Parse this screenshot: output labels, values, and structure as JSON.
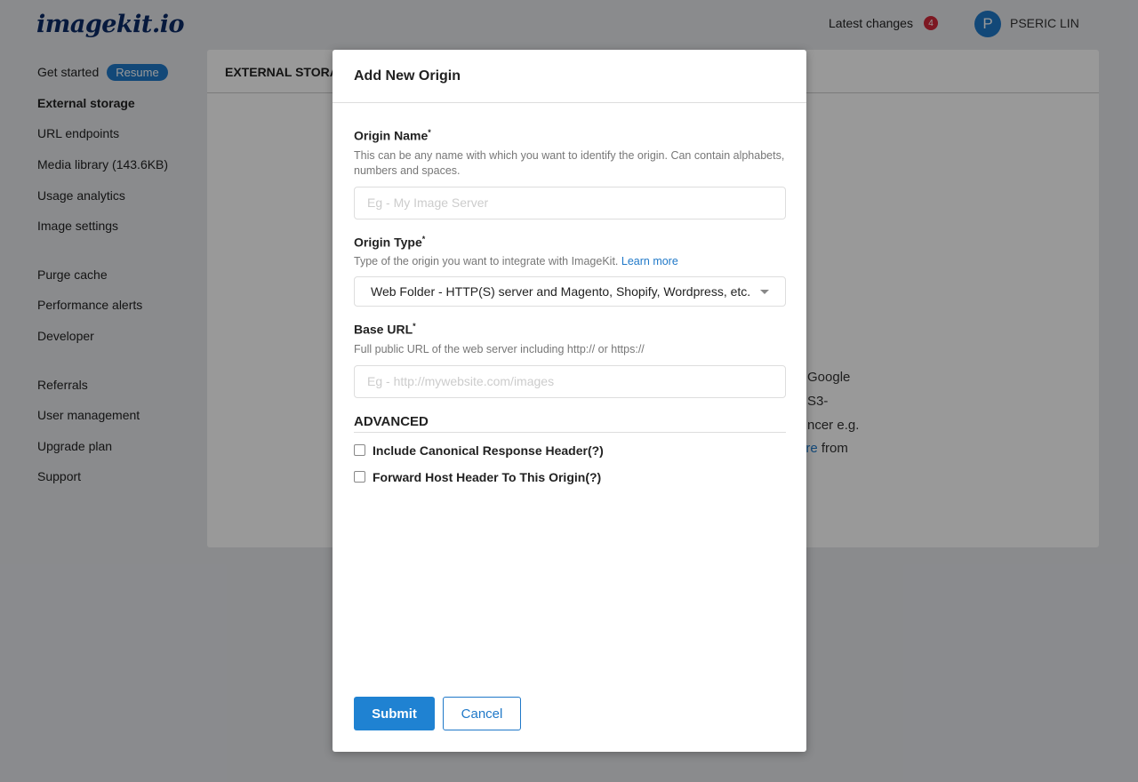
{
  "header": {
    "logo": "imagekit.io",
    "latest_changes": "Latest changes",
    "badge_count": "4",
    "avatar_initial": "P",
    "user_name": "PSERIC LIN"
  },
  "sidebar": {
    "resume": "Resume",
    "groups": [
      [
        "Get started",
        "External storage",
        "URL endpoints",
        "Media library (143.6KB)",
        "Usage analytics",
        "Image settings"
      ],
      [
        "Purge cache",
        "Performance alerts",
        "Developer"
      ],
      [
        "Referrals",
        "User management",
        "Upgrade plan",
        "Support"
      ]
    ],
    "active": "External storage"
  },
  "card": {
    "title": "EXTERNAL STORAGE",
    "fragments": [
      "Google",
      "S3-",
      "ncer e.g.",
      "from"
    ],
    "link_fragment": "ore"
  },
  "modal": {
    "title": "Add New Origin",
    "origin_name": {
      "label": "Origin Name",
      "help": "This can be any name with which you want to identify the origin. Can contain alphabets, numbers and spaces.",
      "placeholder": "Eg - My Image Server"
    },
    "origin_type": {
      "label": "Origin Type",
      "help": "Type of the origin you want to integrate with ImageKit.",
      "link": "Learn more",
      "value": "Web Folder - HTTP(S) server and Magento, Shopify, Wordpress, etc."
    },
    "base_url": {
      "label": "Base URL",
      "help": "Full public URL of the web server including http:// or https://",
      "placeholder": "Eg - http://mywebsite.com/images"
    },
    "advanced": "ADVANCED",
    "checkboxes": [
      {
        "label": "Include Canonical Response Header(?)",
        "checked": false
      },
      {
        "label": "Forward Host Header To This Origin(?)",
        "checked": false
      }
    ],
    "submit": "Submit",
    "cancel": "Cancel"
  },
  "colors": {
    "accent": "#1f78c8",
    "badge": "#d0283a",
    "logo": "#0b2a66"
  }
}
